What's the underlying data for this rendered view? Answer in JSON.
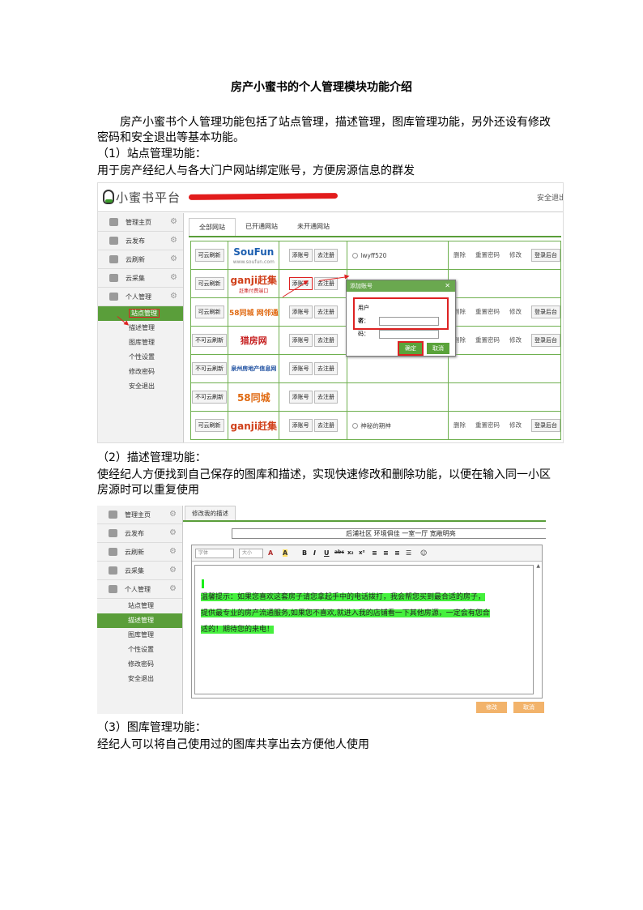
{
  "doc": {
    "title": "房产小蜜书的个人管理模块功能介绍",
    "intro": "房产小蜜书个人管理功能包括了站点管理，描述管理，图库管理功能，另外还设有修改密码和安全退出等基本功能。",
    "sec1_heading": "（1）站点管理功能：",
    "sec1_desc": "用于房产经纪人与各大门户网站绑定账号，方便房源信息的群发",
    "sec2_heading": "（2）描述管理功能：",
    "sec2_desc": "使经纪人方便找到自己保存的图库和描述，实现快速修改和删除功能，以便在输入同一小区房源时可以重复使用",
    "sec3_heading": "（3）图库管理功能：",
    "sec3_desc": "经纪人可以将自己使用过的图库共享出去方便他人使用"
  },
  "shot1": {
    "logo_text": "小蜜书平台",
    "logout_label": "安全退出",
    "sidebar": [
      {
        "label": "管理主页",
        "icon": "home-icon"
      },
      {
        "label": "云发布",
        "icon": "share-icon"
      },
      {
        "label": "云刷新",
        "icon": "printer-icon"
      },
      {
        "label": "云采集",
        "icon": "pie-icon"
      },
      {
        "label": "个人管理",
        "icon": "gear-icon"
      }
    ],
    "sub_items": [
      "站点管理",
      "描述管理",
      "图库管理",
      "个性设置",
      "修改密码",
      "安全退出"
    ],
    "tabs": [
      "全部网站",
      "已开通网站",
      "未开通网站"
    ],
    "rows": [
      {
        "status": "可云刷新",
        "site": "SouFun",
        "site_sub": "www.soufun.com",
        "account": "lwyff520",
        "ops": [
          "删除",
          "重置密码",
          "修改"
        ],
        "login": "登录后台"
      },
      {
        "status": "可云刷新",
        "site": "ganji赶集",
        "site_sub": "赶集付费端口",
        "account": "",
        "ops": [],
        "login": ""
      },
      {
        "status": "可云刷新",
        "site": "58同城 网邻通",
        "site_sub": "",
        "account": "",
        "ops": [
          "删除",
          "重置密码",
          "修改"
        ],
        "login": "登录后台"
      },
      {
        "status": "不可云刷新",
        "site": "猎房网",
        "site_sub": "",
        "account": "",
        "ops": [
          "删除",
          "重置密码",
          "修改"
        ],
        "login": "登录后台"
      },
      {
        "status": "不可云刷新",
        "site": "泉州房地产信息网",
        "site_sub": "",
        "account": "",
        "ops": [],
        "login": ""
      },
      {
        "status": "不可云刷新",
        "site": "58同城",
        "site_sub": "",
        "account": "",
        "ops": [],
        "login": ""
      },
      {
        "status": "可云刷新",
        "site": "ganji赶集",
        "site_sub": "",
        "account": "神秘的期神",
        "ops": [
          "删除",
          "重置密码",
          "修改"
        ],
        "login": "登录后台"
      }
    ],
    "add_account": "添账号",
    "register": "去注册",
    "dialog": {
      "title": "添加账号",
      "username_label": "用户名：",
      "password_label": "密　码：",
      "confirm": "确定",
      "cancel": "取消"
    }
  },
  "shot2": {
    "sidebar": [
      {
        "label": "管理主页",
        "icon": "home-icon"
      },
      {
        "label": "云发布",
        "icon": "share-icon"
      },
      {
        "label": "云刷新",
        "icon": "printer-icon"
      },
      {
        "label": "云采集",
        "icon": "pie-icon"
      },
      {
        "label": "个人管理",
        "icon": "gear-icon"
      }
    ],
    "sub_items": [
      "站点管理",
      "描述管理",
      "图库管理",
      "个性设置",
      "修改密码",
      "安全退出"
    ],
    "tab": "修改我的描述",
    "title_value": "后浦社区 环境俱佳 一室一厅 宽敞明亮",
    "font_select": "字体",
    "size_select": "大小",
    "content_lines": [
      "温馨提示：如果您喜欢这套房子请您拿起手中的电话拨打，我会帮您买到最合适的房子，",
      "提供最专业的房产流通服务,如果您不喜欢,就进入我的店铺看一下其他房源，一定会有您合",
      "适的！期待您的来电！"
    ],
    "modify_button": "修改",
    "cancel_button": "取消"
  }
}
